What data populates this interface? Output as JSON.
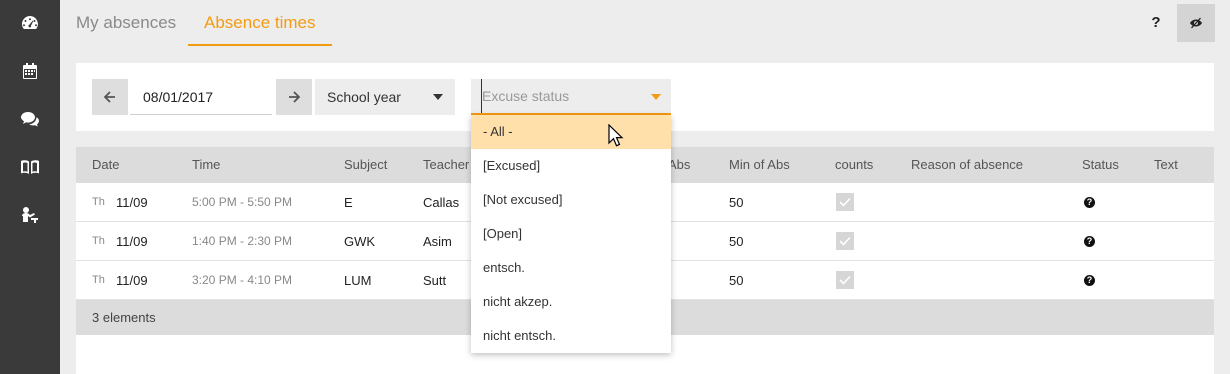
{
  "sidebar": {
    "icons": [
      "dashboard-icon",
      "calendar-icon",
      "chat-icon",
      "book-icon",
      "person-desk-icon"
    ]
  },
  "tabs": [
    {
      "label": "My absences",
      "active": false
    },
    {
      "label": "Absence times",
      "active": true
    }
  ],
  "header": {
    "help_label": "?"
  },
  "filters": {
    "date_value": "08/01/2017",
    "period_value": "School year",
    "excuse_placeholder": "Excuse status"
  },
  "table": {
    "columns": [
      "Date",
      "Time",
      "Subject",
      "Teacher",
      "Abs",
      "Min of Abs",
      "counts",
      "Reason of absence",
      "Status",
      "Text"
    ],
    "rows": [
      {
        "day": "Th",
        "date": "11/09",
        "time": "5:00 PM - 5:50 PM",
        "subject": "E",
        "teacher": "Callas",
        "min_of_abs": "50",
        "counts": true,
        "status": "?"
      },
      {
        "day": "Th",
        "date": "11/09",
        "time": "1:40 PM - 2:30 PM",
        "subject": "GWK",
        "teacher": "Asim",
        "min_of_abs": "50",
        "counts": true,
        "status": "?"
      },
      {
        "day": "Th",
        "date": "11/09",
        "time": "3:20 PM - 4:10 PM",
        "subject": "LUM",
        "teacher": "Sutt",
        "min_of_abs": "50",
        "counts": true,
        "status": "?"
      }
    ],
    "footer": "3 elements"
  },
  "dropdown": {
    "options": [
      "- All -",
      "[Excused]",
      "[Not excused]",
      "[Open]",
      "entsch.",
      "nicht akzep.",
      "nicht entsch."
    ],
    "highlighted_index": 0
  },
  "colors": {
    "accent": "#f39c12",
    "sidebar": "#3a3a3a",
    "highlight": "#ffdfaa"
  }
}
